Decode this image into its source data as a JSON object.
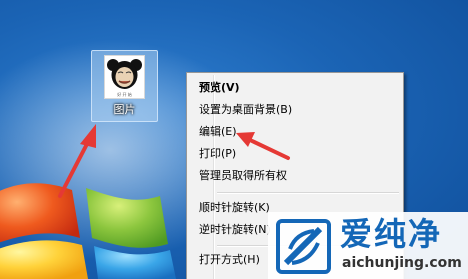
{
  "desktop": {
    "file_icon": {
      "label": "图片",
      "thumbnail_caption": "好 开 始",
      "thumbnail_icon": "panda-meme-thumbnail"
    }
  },
  "context_menu": {
    "items": [
      {
        "label": "预览(V)",
        "bold": true
      },
      {
        "label": "设置为桌面背景(B)",
        "bold": false
      },
      {
        "label": "编辑(E)",
        "bold": false
      },
      {
        "label": "打印(P)",
        "bold": false
      },
      {
        "label": "管理员取得所有权",
        "bold": false
      },
      {
        "label": "顺时针旋转(K)",
        "bold": false
      },
      {
        "label": "逆时针旋转(N)",
        "bold": false
      },
      {
        "label": "打开方式(H)",
        "bold": false
      }
    ]
  },
  "watermark": {
    "title": "爱纯净",
    "url": "aichunjing.com",
    "icon": "logo-mark-icon"
  },
  "colors": {
    "desktop_blue": "#1b64b5",
    "annotation_red": "#e53935",
    "menu_background": "#f2f2f2",
    "logo_blue": "#1467b7"
  }
}
